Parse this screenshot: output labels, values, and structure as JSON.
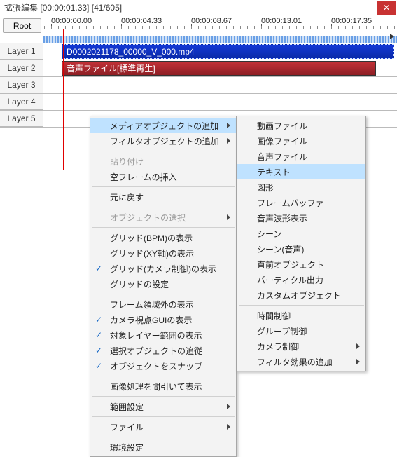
{
  "window": {
    "title": "拡張編集 [00:00:01.33] [41/605]"
  },
  "toolbar": {
    "root_label": "Root"
  },
  "time_ruler": {
    "ticks": [
      "00:00:00.00",
      "00:00:04.33",
      "00:00:08.67",
      "00:00:13.01",
      "00:00:17.35"
    ]
  },
  "layers": {
    "labels": [
      "Layer 1",
      "Layer 2",
      "Layer 3",
      "Layer 4",
      "Layer 5"
    ]
  },
  "clips": {
    "video_label": "D0002021178_00000_V_000.mp4",
    "audio_label": "音声ファイル[標準再生]"
  },
  "menu_main": [
    {
      "label": "メディアオブジェクトの追加",
      "arrow": true,
      "hovered": true
    },
    {
      "label": "フィルタオブジェクトの追加",
      "arrow": true
    },
    {
      "sep": true
    },
    {
      "label": "貼り付け",
      "disabled": true
    },
    {
      "label": "空フレームの挿入"
    },
    {
      "sep": true
    },
    {
      "label": "元に戻す"
    },
    {
      "sep": true
    },
    {
      "label": "オブジェクトの選択",
      "arrow": true,
      "disabled": true
    },
    {
      "sep": true
    },
    {
      "label": "グリッド(BPM)の表示"
    },
    {
      "label": "グリッド(XY軸)の表示"
    },
    {
      "label": "グリッド(カメラ制御)の表示",
      "checked": true
    },
    {
      "label": "グリッドの設定"
    },
    {
      "sep": true
    },
    {
      "label": "フレーム領域外の表示"
    },
    {
      "label": "カメラ視点GUIの表示",
      "checked": true
    },
    {
      "label": "対象レイヤー範囲の表示",
      "checked": true
    },
    {
      "label": "選択オブジェクトの追従",
      "checked": true
    },
    {
      "label": "オブジェクトをスナップ",
      "checked": true
    },
    {
      "sep": true
    },
    {
      "label": "画像処理を間引いて表示"
    },
    {
      "sep": true
    },
    {
      "label": "範囲設定",
      "arrow": true
    },
    {
      "sep": true
    },
    {
      "label": "ファイル",
      "arrow": true
    },
    {
      "sep": true
    },
    {
      "label": "環境設定"
    }
  ],
  "menu_sub": [
    {
      "label": "動画ファイル"
    },
    {
      "label": "画像ファイル"
    },
    {
      "label": "音声ファイル"
    },
    {
      "label": "テキスト",
      "hovered": true
    },
    {
      "label": "図形"
    },
    {
      "label": "フレームバッファ"
    },
    {
      "label": "音声波形表示"
    },
    {
      "label": "シーン"
    },
    {
      "label": "シーン(音声)"
    },
    {
      "label": "直前オブジェクト"
    },
    {
      "label": "パーティクル出力"
    },
    {
      "label": "カスタムオブジェクト"
    },
    {
      "sep": true
    },
    {
      "label": "時間制御"
    },
    {
      "label": "グループ制御"
    },
    {
      "label": "カメラ制御",
      "arrow": true
    },
    {
      "label": "フィルタ効果の追加",
      "arrow": true
    }
  ]
}
